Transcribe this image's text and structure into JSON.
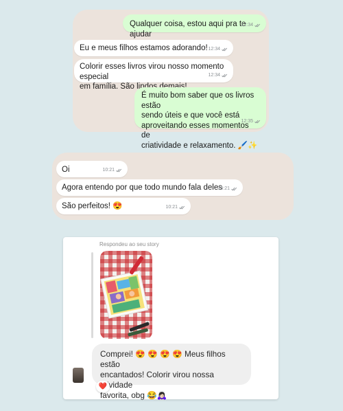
{
  "chat1": {
    "messages": [
      {
        "text": "Qualquer coisa, estou aqui pra te ajudar",
        "time": "12:34"
      },
      {
        "text": "Eu e meus filhos estamos adorando!",
        "time": "12:34"
      },
      {
        "text": "Colorir esses livros virou nosso momento especial\nem família. São lindos demais!",
        "time": "12:34"
      },
      {
        "text": "É muito bom saber que os livros estão\nsendo úteis e que você está\naproveitando esses momentos de\ncriatividade e relaxamento. 🖌️✨",
        "time": "12:35"
      }
    ]
  },
  "chat2": {
    "messages": [
      {
        "text": "Oi",
        "time": "10:21"
      },
      {
        "text": "Agora entendo por que todo mundo fala deles",
        "time": "10:21"
      },
      {
        "text": "São perfeitos! 😍",
        "time": "10:21"
      }
    ]
  },
  "instagram": {
    "caption": "Respondeu ao seu story",
    "reply": "Comprei!  😍 😍 😍 😍  Meus filhos estão\nencantados! Colorir virou nossa atividade\nfavorita, obg 😂🙇🏻‍♀️",
    "reaction": "❤️"
  },
  "colors": {
    "background": "#dbe9ec",
    "panel": "#ece3dc",
    "outgoing_bubble": "#d9fdd3",
    "incoming_bubble": "#ffffff",
    "tick": "#8a8f93"
  }
}
